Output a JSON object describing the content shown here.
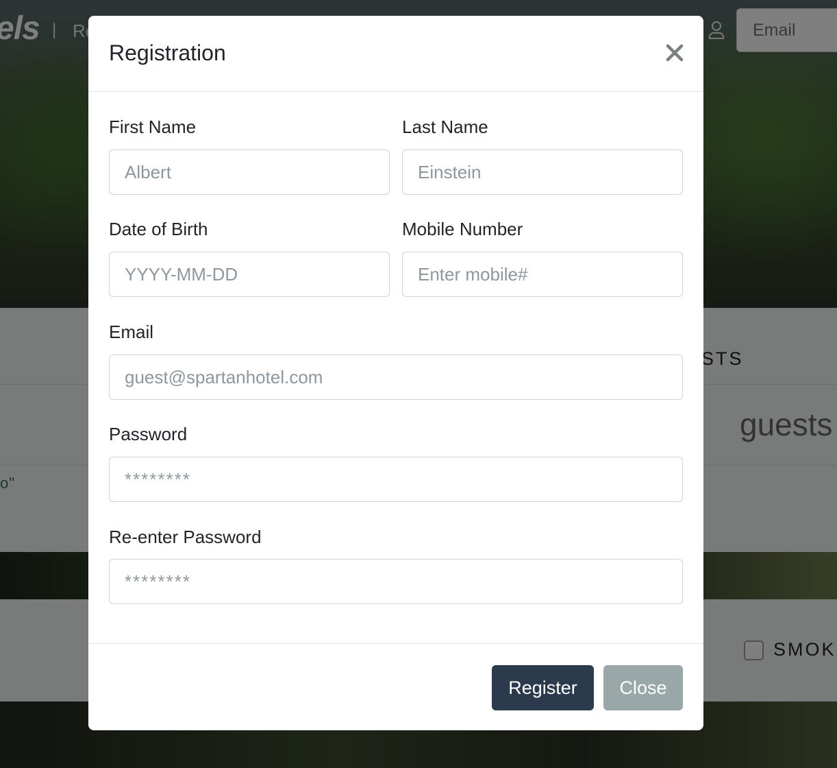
{
  "background": {
    "logo": "els",
    "separator": "|",
    "nav_text": "Re",
    "email_placeholder": "Email",
    "tab_text": "STS",
    "guests_text": "guests",
    "quote_text": "o\"",
    "checkbox_label": "SMOKI"
  },
  "modal": {
    "title": "Registration",
    "fields": {
      "first_name": {
        "label": "First Name",
        "placeholder": "Albert",
        "value": ""
      },
      "last_name": {
        "label": "Last Name",
        "placeholder": "Einstein",
        "value": ""
      },
      "dob": {
        "label": "Date of Birth",
        "placeholder": "YYYY-MM-DD",
        "value": ""
      },
      "mobile": {
        "label": "Mobile Number",
        "placeholder": "Enter mobile#",
        "value": ""
      },
      "email": {
        "label": "Email",
        "placeholder": "guest@spartanhotel.com",
        "value": ""
      },
      "password": {
        "label": "Password",
        "placeholder": "********",
        "value": ""
      },
      "password_confirm": {
        "label": "Re-enter Password",
        "placeholder": "********",
        "value": ""
      }
    },
    "buttons": {
      "register": "Register",
      "close": "Close"
    }
  },
  "colors": {
    "primary_button": "#2c3a4d",
    "secondary_button": "#9aa7a8",
    "backdrop": "rgba(0,0,0,0.5)"
  },
  "icons": {
    "close": "close-icon",
    "user": "user-icon"
  }
}
